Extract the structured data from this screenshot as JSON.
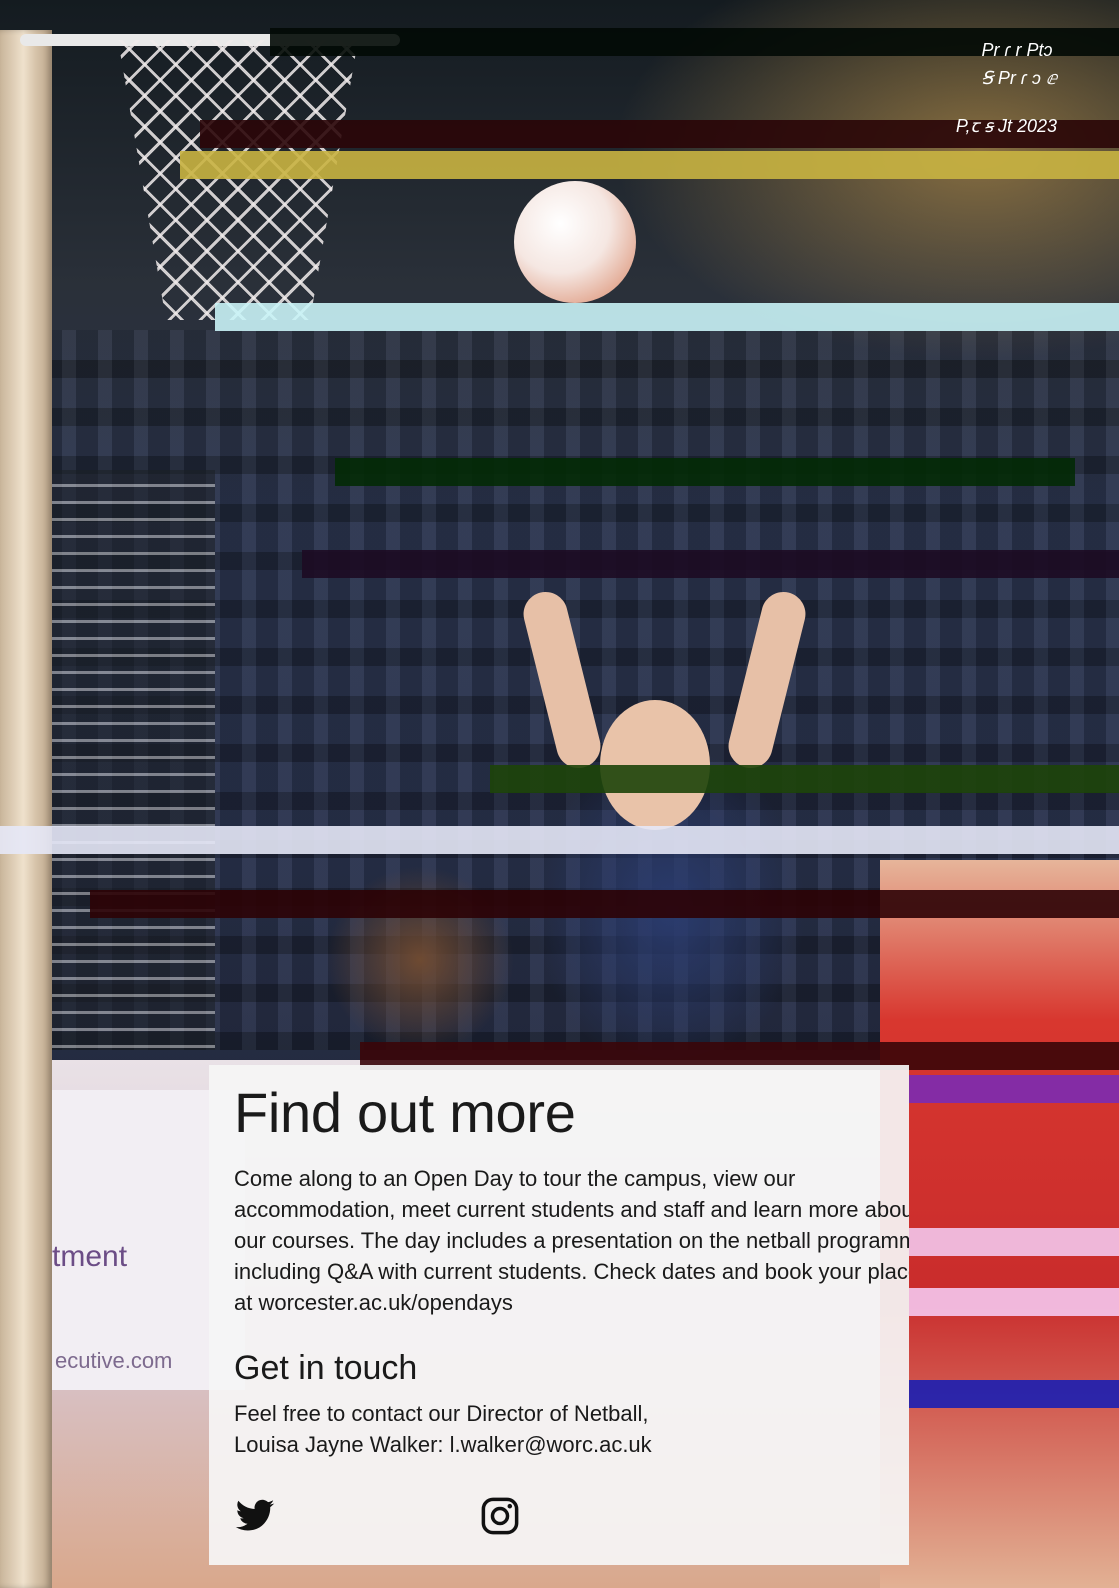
{
  "header": {
    "social_line_1": "Pr ɾ   r  Ptɔ",
    "social_line_2": "Ꞩ    Pr ɾ  ͻ ⅇ",
    "social_line_3": "P,ꞇ ꞩ   Jt   ",
    "year": "2023"
  },
  "background": {
    "sponsor_text_1": "tment",
    "sponsor_text_2": "ecutive.com"
  },
  "main": {
    "title": "Find out more",
    "intro": "Come along to an Open Day to tour the campus, view our accommodation, meet current students and staff and learn more about our courses. The day includes a presentation on the netball programme including Q&A with current students. Check dates and book your place at ",
    "intro_link": "worcester.ac.uk/opendays",
    "contact_heading": "Get in touch",
    "contact_line_1": "Feel free to contact our Director of Netball,",
    "contact_line_2": "Louisa Jayne Walker: l.walker@worc.ac.uk"
  },
  "socials": {
    "twitter_icon": "twitter-icon",
    "instagram_icon": "instagram-icon"
  },
  "colors": {
    "card_background": "#f5f5f5",
    "text": "#1a1a1a",
    "accent_red": "#d8372f",
    "navy": "#27304a"
  }
}
